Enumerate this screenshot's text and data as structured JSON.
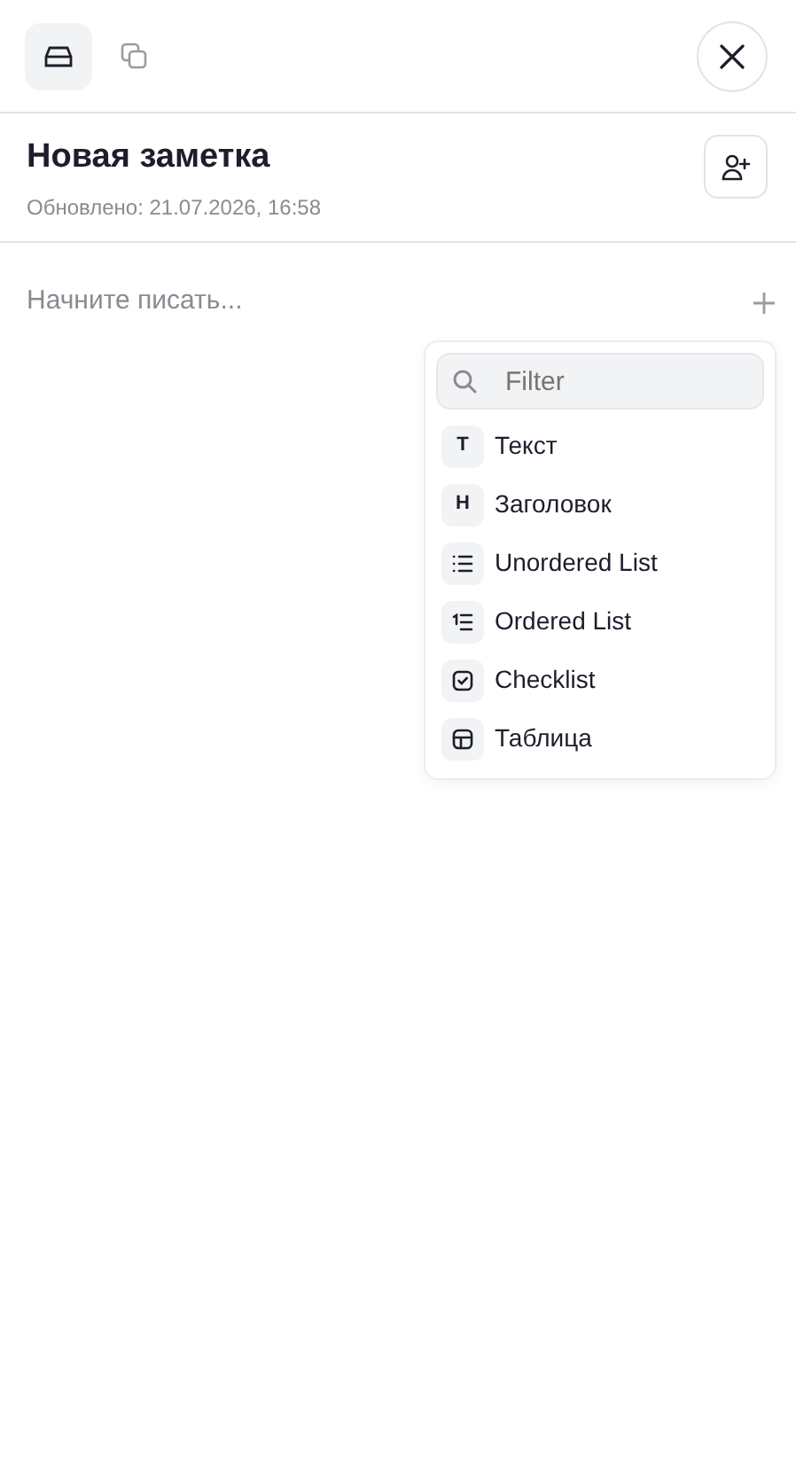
{
  "toolbar": {
    "tabs": [
      {
        "kind": "tray",
        "selected": true
      },
      {
        "kind": "copy",
        "selected": false
      }
    ]
  },
  "note": {
    "title": "Новая заметка",
    "updated": "Обновлено: 21.07.2026, 16:58"
  },
  "editor": {
    "placeholder": "Начните писать..."
  },
  "block_menu": {
    "search": {
      "placeholder": "Filter"
    },
    "items": [
      {
        "kind": "glyph",
        "glyph": "T",
        "label": "Текст"
      },
      {
        "kind": "glyph",
        "glyph": "H",
        "label": "Заголовок"
      },
      {
        "kind": "bullets",
        "label": "Unordered List"
      },
      {
        "kind": "numbers",
        "label": "Ordered List"
      },
      {
        "kind": "checklist",
        "label": "Checklist"
      },
      {
        "kind": "table",
        "label": "Таблица"
      }
    ]
  }
}
